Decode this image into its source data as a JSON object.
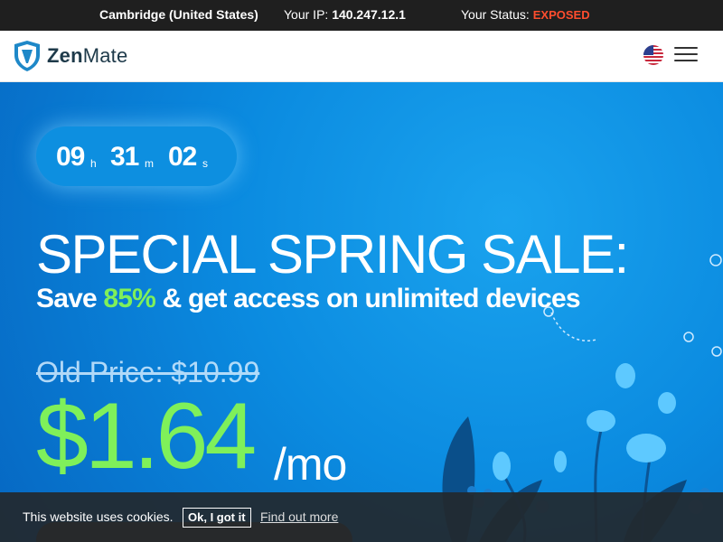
{
  "topbar": {
    "location": "Cambridge (United States)",
    "ip_label": "Your IP:",
    "ip_value": "140.247.12.1",
    "status_label": "Your Status:",
    "status_value": "EXPOSED",
    "status_color": "#ff4d2e"
  },
  "nav": {
    "logo_zen": "Zen",
    "logo_mate": "Mate",
    "flag_icon": "us-flag-icon",
    "menu_icon": "hamburger-menu-icon"
  },
  "hero": {
    "timer": {
      "hours": "09",
      "hours_unit": "h",
      "minutes": "31",
      "minutes_unit": "m",
      "seconds": "02",
      "seconds_unit": "s"
    },
    "title": "SPECIAL SPRING SALE:",
    "subtitle_before": "Save ",
    "subtitle_pct": "85%",
    "subtitle_after": " & get access on unlimited devices",
    "old_price": "Old Price: $10.99",
    "price": "$1.64",
    "per": "/mo",
    "accent_color": "#7ff05a"
  },
  "cookie": {
    "message": "This website uses cookies.",
    "ok_label": "Ok, I got it",
    "find_label": "Find out more"
  }
}
